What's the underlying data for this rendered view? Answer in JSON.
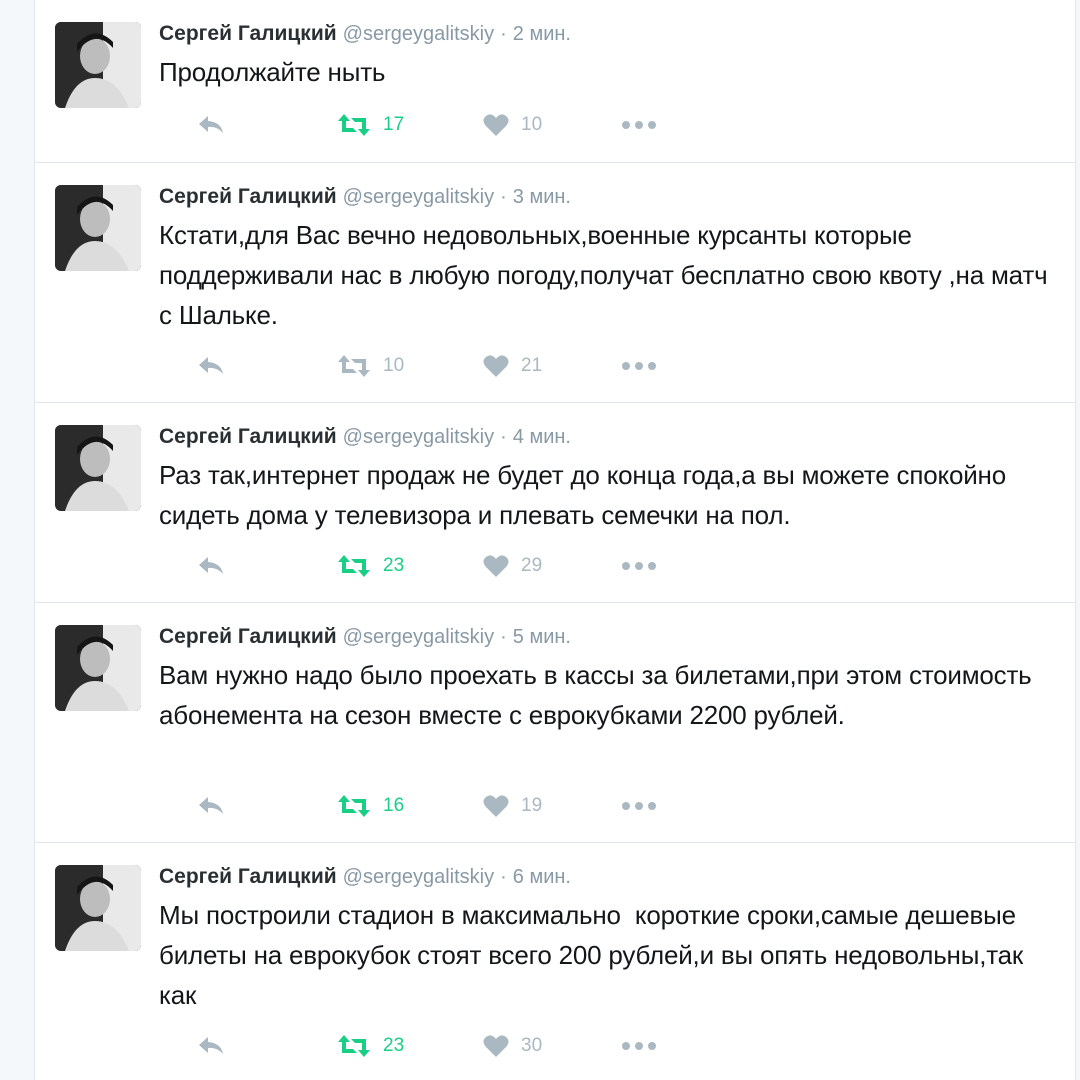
{
  "author": {
    "name": "Сергей Галицкий",
    "handle": "@sergeygalitskiy",
    "separator": "·"
  },
  "tweets": [
    {
      "time": "2 мин.",
      "text": "Продолжайте ныть",
      "retweets": "17",
      "likes": "10",
      "retweeted": true
    },
    {
      "time": "3 мин.",
      "text": "Кстати,для Вас вечно недовольных,военные курсанты которые поддерживали нас в любую погоду,получат бесплатно свою квоту ,на матч с Шальке.",
      "retweets": "10",
      "likes": "21",
      "retweeted": false
    },
    {
      "time": "4 мин.",
      "text": "Раз так,интернет продаж не будет до конца года,а вы можете спокойно сидеть дома у телевизора и плевать семечки на пол.",
      "retweets": "23",
      "likes": "29",
      "retweeted": true
    },
    {
      "time": "5 мин.",
      "text": "Вам нужно надо было проехать в кассы за билетами,при этом стоимость абонемента на сезон вместе с еврокубками 2200 рублей.",
      "retweets": "16",
      "likes": "19",
      "retweeted": true
    },
    {
      "time": "6 мин.",
      "text": "Мы построили стадион в максимально  короткие сроки,самые дешевые билеты на еврокубок стоят всего 200 рублей,и вы опять недовольны,так как",
      "retweets": "23",
      "likes": "30",
      "retweeted": true
    }
  ],
  "icons": {
    "reply": "reply-icon",
    "retweet": "retweet-icon",
    "like": "heart-icon",
    "more": "more-icon"
  },
  "colors": {
    "retweet_active": "#19cf86",
    "icon_inactive": "#aab8c2",
    "secondary_text": "#8899a6"
  }
}
